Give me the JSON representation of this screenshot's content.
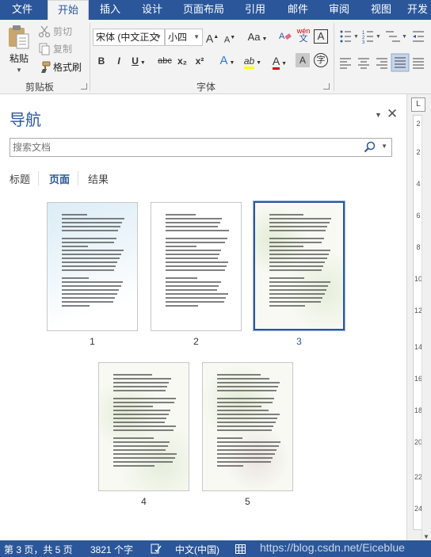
{
  "ribbon": {
    "tabs": [
      "文件",
      "开始",
      "插入",
      "设计",
      "页面布局",
      "引用",
      "邮件",
      "审阅",
      "视图",
      "开发"
    ],
    "active_tab_index": 1,
    "clipboard": {
      "paste": "粘贴",
      "cut": "剪切",
      "copy": "复制",
      "format_painter": "格式刷",
      "group_label": "剪贴板"
    },
    "font": {
      "font_name": "宋体 (中文正文",
      "font_size": "小四",
      "grow": "A",
      "shrink": "A",
      "change_case": "Aa",
      "bold": "B",
      "italic": "I",
      "underline": "U",
      "strikethrough": "abc",
      "subscript": "x₂",
      "superscript": "x²",
      "group_label": "字体",
      "phonetic_top": "wén",
      "phonetic_bottom": "文",
      "char_border": "A",
      "text_effects": "A",
      "highlight": "ab",
      "font_color": "A",
      "char_shading": "A",
      "enclose": "字"
    }
  },
  "nav": {
    "title": "导航",
    "search_placeholder": "搜索文档",
    "tabs": [
      "标题",
      "页面",
      "结果"
    ],
    "active_tab_index": 1,
    "pages": [
      {
        "number": "1",
        "selected": false
      },
      {
        "number": "2",
        "selected": false
      },
      {
        "number": "3",
        "selected": true
      },
      {
        "number": "4",
        "selected": false
      },
      {
        "number": "5",
        "selected": false
      }
    ]
  },
  "ruler": {
    "numbers": [
      "2",
      "2",
      "4",
      "6",
      "8",
      "10",
      "12",
      "14",
      "16",
      "18",
      "20",
      "22",
      "24"
    ]
  },
  "status": {
    "page": "第 3 页，共 5 页",
    "words": "3821 个字",
    "language": "中文(中国)"
  },
  "watermark": "https://blog.csdn.net/Eiceblue",
  "colors": {
    "accent": "#2b579a",
    "ribbon_bg": "#f3f3f3"
  }
}
